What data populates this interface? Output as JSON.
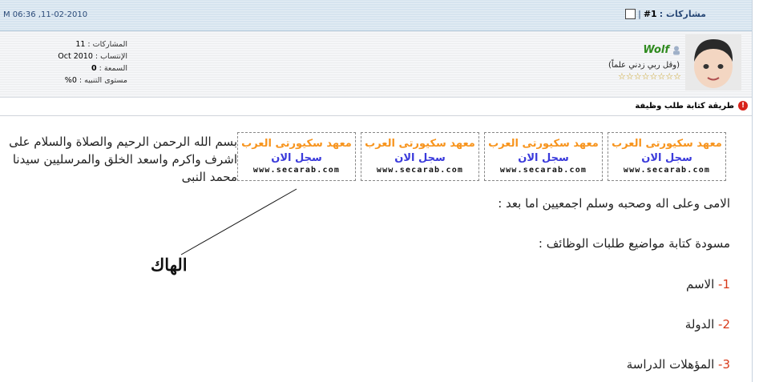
{
  "header": {
    "date": "M 06:36 ,11-02-2010",
    "post_label": "مشاركات : ",
    "post_number": "#1",
    "separator": "|"
  },
  "user": {
    "name": "Wolf",
    "title": "(وقل ربي زدني علماً)",
    "reputation_stars": [
      "☆",
      "☆",
      "☆",
      "☆",
      "☆",
      "☆",
      "☆",
      "☆"
    ],
    "stats": {
      "posts_label": "المشاركات : ",
      "posts_value": "11",
      "joined_label": "الإنتساب : ",
      "joined_value": "Oct 2010",
      "reputation_label": "السمعة : ",
      "reputation_value": "0",
      "alert_label": "مستوى التنبيه : ",
      "alert_value": "0%"
    }
  },
  "post": {
    "title": "طريقة كتابة طلب وظيفة",
    "intro": "بسم الله الرحمن الرحيم والصلاة والسلام على اشرف واكرم واسعد الخلق والمرسليين سيدنا محمد النبى",
    "line2": "الامى وعلى اله وصحبه وسلم اجمعيين اما بعد :",
    "line3": "مسودة كتابة مواضيع طلبات الوظائف :",
    "items": [
      {
        "num": "1-",
        "text": " الاسم"
      },
      {
        "num": "2-",
        "text": " الدولة"
      },
      {
        "num": "3-",
        "text": " المؤهلات الدراسة"
      }
    ],
    "annotation": "الهاك"
  },
  "ads": [
    {
      "line1": "معهد سكيورتى العرب",
      "line2": "سجل الان",
      "line3": "www.secarab.com"
    },
    {
      "line1": "معهد سكيورتى العرب",
      "line2": "سجل الان",
      "line3": "www.secarab.com"
    },
    {
      "line1": "معهد سكيورتى العرب",
      "line2": "سجل الان",
      "line3": "www.secarab.com"
    },
    {
      "line1": "معهد سكيورتى العرب",
      "line2": "سجل الان",
      "line3": "www.secarab.com"
    }
  ],
  "colors": {
    "header_bg": "#d6e4ef",
    "username": "#2f8b1f",
    "ad_orange": "#f7941d",
    "ad_blue": "#3a3adb",
    "list_number": "#d83a1a"
  }
}
